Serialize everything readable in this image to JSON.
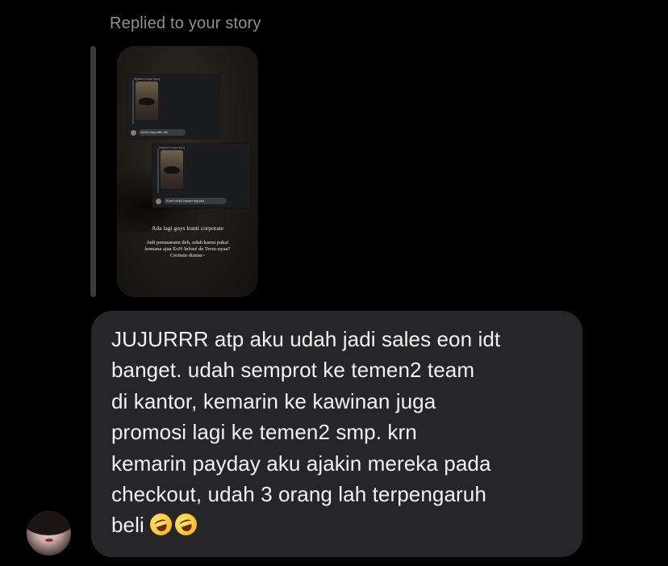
{
  "reply": {
    "header": "Replied to your story"
  },
  "story": {
    "mini_card_1": {
      "header": "Replied to your story",
      "bubble_text": "kunti corporate nih"
    },
    "mini_card_2": {
      "header": "Replied to your story",
      "bubble_text": "Kunti mba2 lawyer deposit"
    },
    "caption_line_1": "Ada lagi guys kunti corporate",
    "caption_lines": [
      "Jadi penasarann deh, udah kamu pakai",
      "kemana ajaa EoN Infusé de Terra-nyaa?",
      "Ceritain dumss~"
    ]
  },
  "message": {
    "lines": [
      "JUJURRR atp aku udah jadi sales eon idt",
      "banget. udah semprot ke temen2 team",
      "di kantor, kemarin ke kawinan juga",
      "promosi lagi ke temen2 smp. krn",
      "kemarin payday aku ajakin mereka pada",
      "checkout, udah 3 orang lah terpengaruh",
      "beli"
    ],
    "emojis": [
      "rolling-on-floor-laughing-icon",
      "rolling-on-floor-laughing-icon"
    ]
  },
  "colors": {
    "background": "#000000",
    "bubble": "#262629",
    "header_text": "#8e8e93",
    "message_text": "#f2f2f2"
  }
}
